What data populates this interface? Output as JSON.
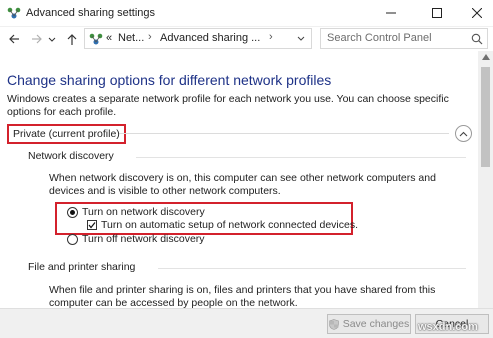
{
  "window": {
    "title": "Advanced sharing settings",
    "minimize_icon": "minimize-icon",
    "maximize_icon": "maximize-icon",
    "close_icon": "close-icon"
  },
  "nav": {
    "back_icon": "back-arrow-icon",
    "forward_icon": "forward-arrow-icon",
    "history_icon": "chevron-down-icon",
    "up_icon": "up-arrow-icon",
    "breadcrumb": {
      "overflow": "«",
      "items": [
        "Net...",
        "Advanced sharing ..."
      ],
      "separator": "›"
    },
    "refresh_icon": "refresh-icon",
    "search": {
      "placeholder": "Search Control Panel"
    }
  },
  "main": {
    "heading": "Change sharing options for different network profiles",
    "description": "Windows creates a separate network profile for each network you use. You can choose specific options for each profile.",
    "profile": {
      "label": "Private (current profile)",
      "collapse_icon": "chevron-up-icon"
    },
    "network_discovery": {
      "heading": "Network discovery",
      "description": "When network discovery is on, this computer can see other network computers and devices and is visible to other network computers.",
      "options": [
        {
          "label": "Turn on network discovery",
          "selected": true
        },
        {
          "label": "Turn off network discovery",
          "selected": false
        }
      ],
      "auto_setup": {
        "label": "Turn on automatic setup of network connected devices.",
        "checked": true
      }
    },
    "file_printer_sharing": {
      "heading": "File and printer sharing",
      "description": "When file and printer sharing is on, files and printers that you have shared from this computer can be accessed by people on the network."
    }
  },
  "footer": {
    "save_label": "Save changes",
    "cancel_label": "Cancel",
    "watermark": "wsxdn.com"
  },
  "colors": {
    "heading": "#1e3287",
    "highlight": "#d3212c"
  }
}
